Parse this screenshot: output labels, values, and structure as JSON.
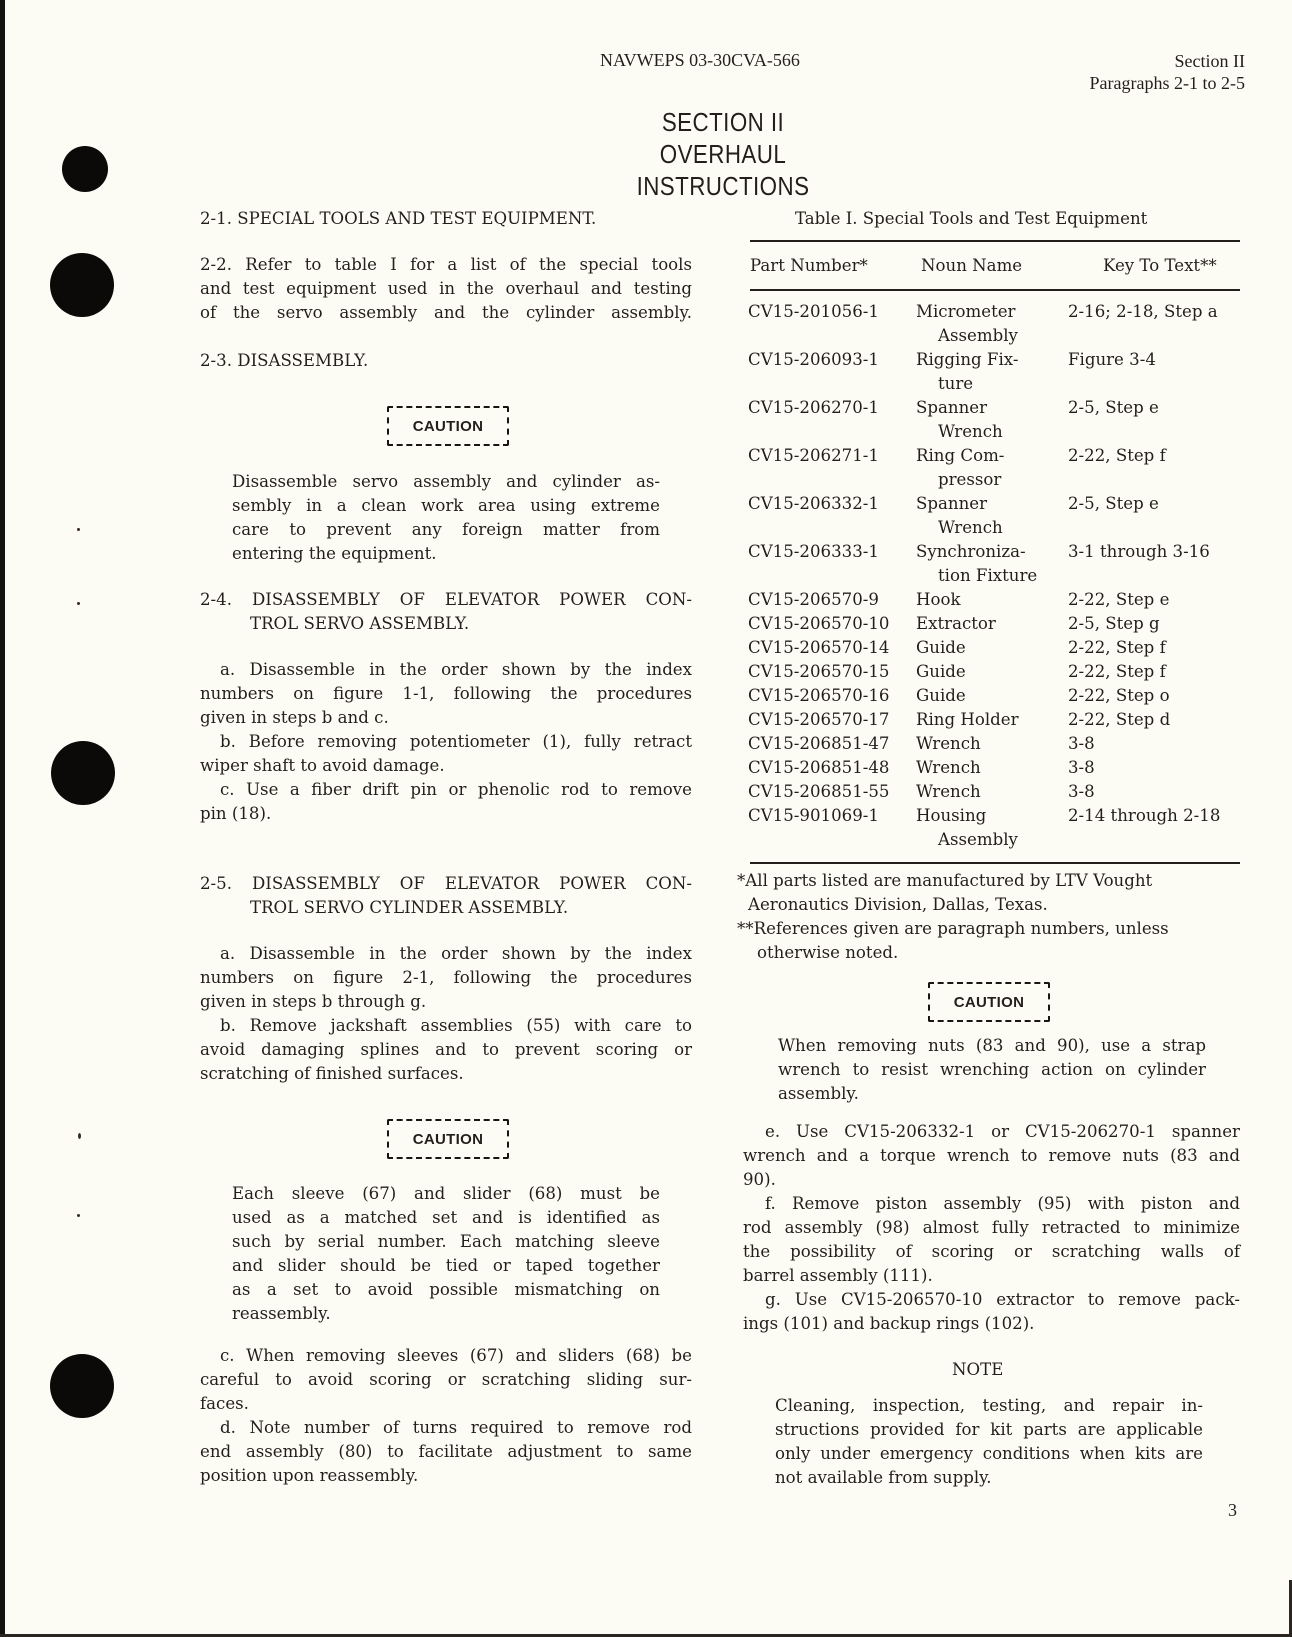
{
  "header": {
    "doc_number": "NAVWEPS 03-30CVA-566",
    "section": "Section II",
    "paragraphs": "Paragraphs 2-1 to 2-5"
  },
  "title": {
    "line1": "SECTION II",
    "line2": "OVERHAUL INSTRUCTIONS"
  },
  "left": {
    "p2_1": "2-1. SPECIAL TOOLS AND TEST EQUIPMENT.",
    "p2_2": [
      "2-2. Refer to table I for a list of the special tools",
      "and test equipment used in the overhaul and testing",
      "of the servo assembly and the cylinder assembly."
    ],
    "p2_3": "2-3. DISASSEMBLY.",
    "caution1_label": "CAUTION",
    "caution1_text": [
      "Disassemble servo assembly and cylinder as-",
      "sembly in a clean work area using extreme",
      "care to prevent any foreign matter from",
      "entering the equipment."
    ],
    "p2_4_title": [
      "2-4. DISASSEMBLY OF ELEVATOR POWER CON-",
      "TROL SERVO ASSEMBLY."
    ],
    "p2_4_steps": [
      "a. Disassemble in the order shown by the index",
      "numbers on figure 1-1, following the procedures",
      "given in steps b and c.",
      "b. Before removing potentiometer (1), fully retract",
      "wiper shaft to avoid damage.",
      "c. Use a fiber drift pin or phenolic rod to remove",
      "pin (18)."
    ],
    "p2_5_title": [
      "2-5. DISASSEMBLY OF ELEVATOR POWER CON-",
      "TROL SERVO CYLINDER ASSEMBLY."
    ],
    "p2_5_steps_ab": [
      "a. Disassemble in the order shown by the index",
      "numbers on figure 2-1, following the procedures",
      "given in steps b through g.",
      "b. Remove jackshaft assemblies (55) with care to",
      "avoid damaging splines and to prevent scoring or",
      "scratching of finished surfaces."
    ],
    "caution2_label": "CAUTION",
    "caution2_text": [
      "Each sleeve (67) and slider (68) must be",
      "used as a matched set and is identified as",
      "such by serial number. Each matching sleeve",
      "and slider should be tied or taped together",
      "as a set to avoid possible mismatching on",
      "reassembly."
    ],
    "p2_5_steps_cd": [
      "c. When removing sleeves (67) and sliders (68) be",
      "careful to avoid scoring or scratching sliding sur-",
      "faces.",
      "d. Note number of turns required to remove rod",
      "end assembly (80) to facilitate adjustment to same",
      "position upon reassembly."
    ]
  },
  "table": {
    "caption": "Table I. Special Tools and Test Equipment",
    "headers": [
      "Part Number*",
      "Noun Name",
      "Key To Text**"
    ],
    "rows": [
      {
        "part": "CV15-201056-1",
        "noun": [
          "Micrometer",
          "Assembly"
        ],
        "key": "2-16; 2-18, Step a"
      },
      {
        "part": "CV15-206093-1",
        "noun": [
          "Rigging Fix-",
          "ture"
        ],
        "key": "Figure 3-4"
      },
      {
        "part": "CV15-206270-1",
        "noun": [
          "Spanner",
          "Wrench"
        ],
        "key": "2-5, Step e"
      },
      {
        "part": "CV15-206271-1",
        "noun": [
          "Ring Com-",
          "pressor"
        ],
        "key": "2-22, Step f"
      },
      {
        "part": "CV15-206332-1",
        "noun": [
          "Spanner",
          "Wrench"
        ],
        "key": "2-5, Step e"
      },
      {
        "part": "CV15-206333-1",
        "noun": [
          "Synchroniza-",
          "tion Fixture"
        ],
        "key": "3-1 through 3-16"
      },
      {
        "part": "CV15-206570-9",
        "noun": [
          "Hook"
        ],
        "key": "2-22, Step e"
      },
      {
        "part": "CV15-206570-10",
        "noun": [
          "Extractor"
        ],
        "key": "2-5, Step g"
      },
      {
        "part": "CV15-206570-14",
        "noun": [
          "Guide"
        ],
        "key": "2-22, Step f"
      },
      {
        "part": "CV15-206570-15",
        "noun": [
          "Guide"
        ],
        "key": "2-22, Step f"
      },
      {
        "part": "CV15-206570-16",
        "noun": [
          "Guide"
        ],
        "key": "2-22, Step o"
      },
      {
        "part": "CV15-206570-17",
        "noun": [
          "Ring Holder"
        ],
        "key": "2-22, Step d"
      },
      {
        "part": "CV15-206851-47",
        "noun": [
          "Wrench"
        ],
        "key": "3-8"
      },
      {
        "part": "CV15-206851-48",
        "noun": [
          "Wrench"
        ],
        "key": "3-8"
      },
      {
        "part": "CV15-206851-55",
        "noun": [
          "Wrench"
        ],
        "key": "3-8"
      },
      {
        "part": "CV15-901069-1",
        "noun": [
          "Housing",
          "Assembly"
        ],
        "key": "2-14 through 2-18"
      }
    ],
    "footnotes": [
      [
        "*All parts listed are manufactured by LTV Vought",
        "Aeronautics Division, Dallas, Texas."
      ],
      [
        "**References given are paragraph numbers, unless",
        "otherwise noted."
      ]
    ]
  },
  "right": {
    "caution3_label": "CAUTION",
    "caution3_text": [
      "When removing nuts (83 and 90), use a strap",
      "wrench to resist wrenching action on cylinder",
      "assembly."
    ],
    "steps_efg": [
      "e. Use CV15-206332-1 or CV15-206270-1 spanner",
      "wrench and a torque wrench to remove nuts (83 and",
      "90).",
      "f. Remove piston assembly (95) with piston and",
      "rod assembly (98) almost fully retracted to minimize",
      "the possibility of scoring or scratching walls of",
      "barrel assembly (111).",
      "g. Use CV15-206570-10 extractor to remove pack-",
      "ings (101) and backup rings (102)."
    ],
    "note_label": "NOTE",
    "note_text": [
      "Cleaning, inspection, testing, and repair in-",
      "structions provided for kit parts are applicable",
      "only under emergency conditions when kits are",
      "not available from supply."
    ]
  },
  "page_number": "3"
}
